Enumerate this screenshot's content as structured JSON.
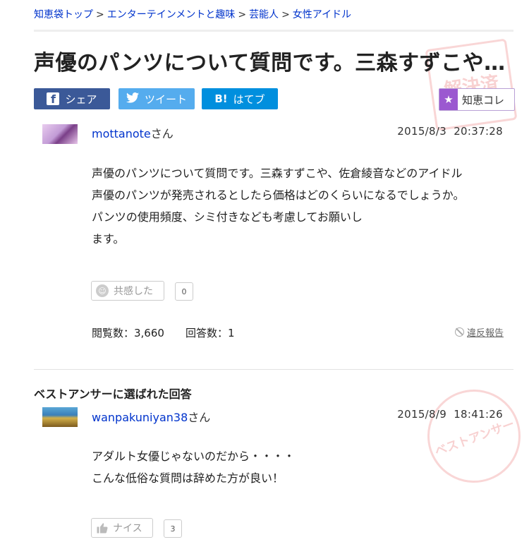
{
  "breadcrumb": {
    "items": [
      "知恵袋トップ",
      "エンターテインメントと趣味",
      "芸能人",
      "女性アイドル"
    ],
    "separator": ">"
  },
  "question": {
    "title": "声優のパンツについて質問です。三森すずこや…",
    "user_name": "mottanote",
    "user_suffix": "さん",
    "date": "2015/8/3",
    "time": "20:37:28",
    "body": [
      "声優のパンツについて質問です。三森すずこや、佐倉綾音などのアイドル",
      "声優のパンツが発売されるとしたら価格はどのくらいになるでしょうか。",
      "パンツの使用頻度、シミ付きなども考慮してお願いし",
      "ます。"
    ],
    "empathy_label": "共感した",
    "empathy_count": "0",
    "views": "閲覧数：3,660",
    "answers": "回答数：1",
    "report_label": "違反報告"
  },
  "share": {
    "facebook": "シェア",
    "twitter": "ツイート",
    "hatena": "はてブ",
    "hatena_icon": "B!"
  },
  "chiekore": {
    "label": "知恵コレ"
  },
  "best_answer": {
    "heading": "ベストアンサーに選ばれた回答",
    "user_name": "wanpakuniyan38",
    "user_suffix": "さん",
    "date": "2015/8/9",
    "time": "18:41:26",
    "body": [
      "アダルト女優じゃないのだから・・・・",
      "こんな低俗な質問は辞めた方が良い！"
    ],
    "nice_label": "ナイス",
    "nice_count": "3"
  },
  "colors": {
    "link": "#0033cc",
    "facebook": "#3b5998",
    "twitter": "#55acee",
    "hatena": "#008fde",
    "chiekore": "#9b59d0"
  }
}
